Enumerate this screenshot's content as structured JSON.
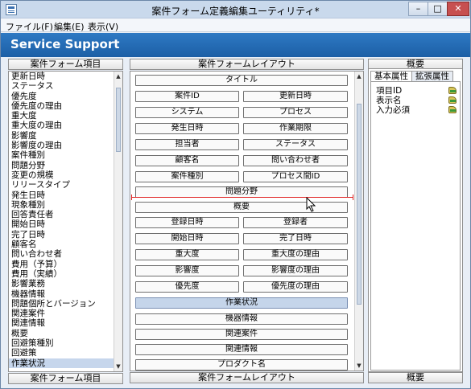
{
  "window": {
    "title": "案件フォーム定義編集ユーティリティ*",
    "controls": {
      "minimize": "–",
      "maximize": "□",
      "close": "✕"
    }
  },
  "menu": [
    "ファイル(F)",
    "編集(E)",
    "表示(V)"
  ],
  "banner": {
    "title": "Service Support",
    "color": "#2271b8"
  },
  "left_panel": {
    "header": "案件フォーム項目",
    "footer": "案件フォーム項目",
    "items": [
      "更新日時",
      "ステータス",
      "優先度",
      "優先度の理由",
      "重大度",
      "重大度の理由",
      "影響度",
      "影響度の理由",
      "案件種別",
      "問題分野",
      "変更の規模",
      "リリースタイプ",
      "発生日時",
      "現象種別",
      "回答責任者",
      "開始日時",
      "完了日時",
      "顧客名",
      "問い合わせ者",
      "費用（予算）",
      "費用（実績）",
      "影響業務",
      "機器情報",
      "問題個所とバージョン",
      "関連案件",
      "関連情報",
      "概要",
      "回避策種別",
      "回避策",
      "作業状況"
    ],
    "selected_index": 29
  },
  "center_panel": {
    "header": "案件フォームレイアウト",
    "footer": "案件フォームレイアウト",
    "fields": {
      "title": "タイトル",
      "case_id": "案件ID",
      "updated": "更新日時",
      "system": "システム",
      "process": "プロセス",
      "occurred": "発生日時",
      "deadline": "作業期限",
      "assignee": "担当者",
      "status": "ステータス",
      "customer": "顧客名",
      "inquirer": "問い合わせ者",
      "case_type": "案件種別",
      "process_id": "プロセス間ID",
      "problem_area": "問題分野",
      "summary": "概要",
      "registered": "登録日時",
      "registrant": "登録者",
      "start": "開始日時",
      "complete": "完了日時",
      "severity": "重大度",
      "severity_reason": "重大度の理由",
      "impact": "影響度",
      "impact_reason": "影響度の理由",
      "priority": "優先度",
      "priority_reason": "優先度の理由",
      "work_status": "作業状況",
      "equipment": "機器情報",
      "related_case": "関連案件",
      "related_info": "関連情報",
      "product_name": "プロダクト名"
    }
  },
  "right_panel": {
    "header": "概要",
    "footer": "概要",
    "tabs": [
      "基本属性",
      "拡張属性"
    ],
    "active_tab": 0,
    "properties": [
      "項目ID",
      "表示名",
      "入力必須"
    ]
  }
}
